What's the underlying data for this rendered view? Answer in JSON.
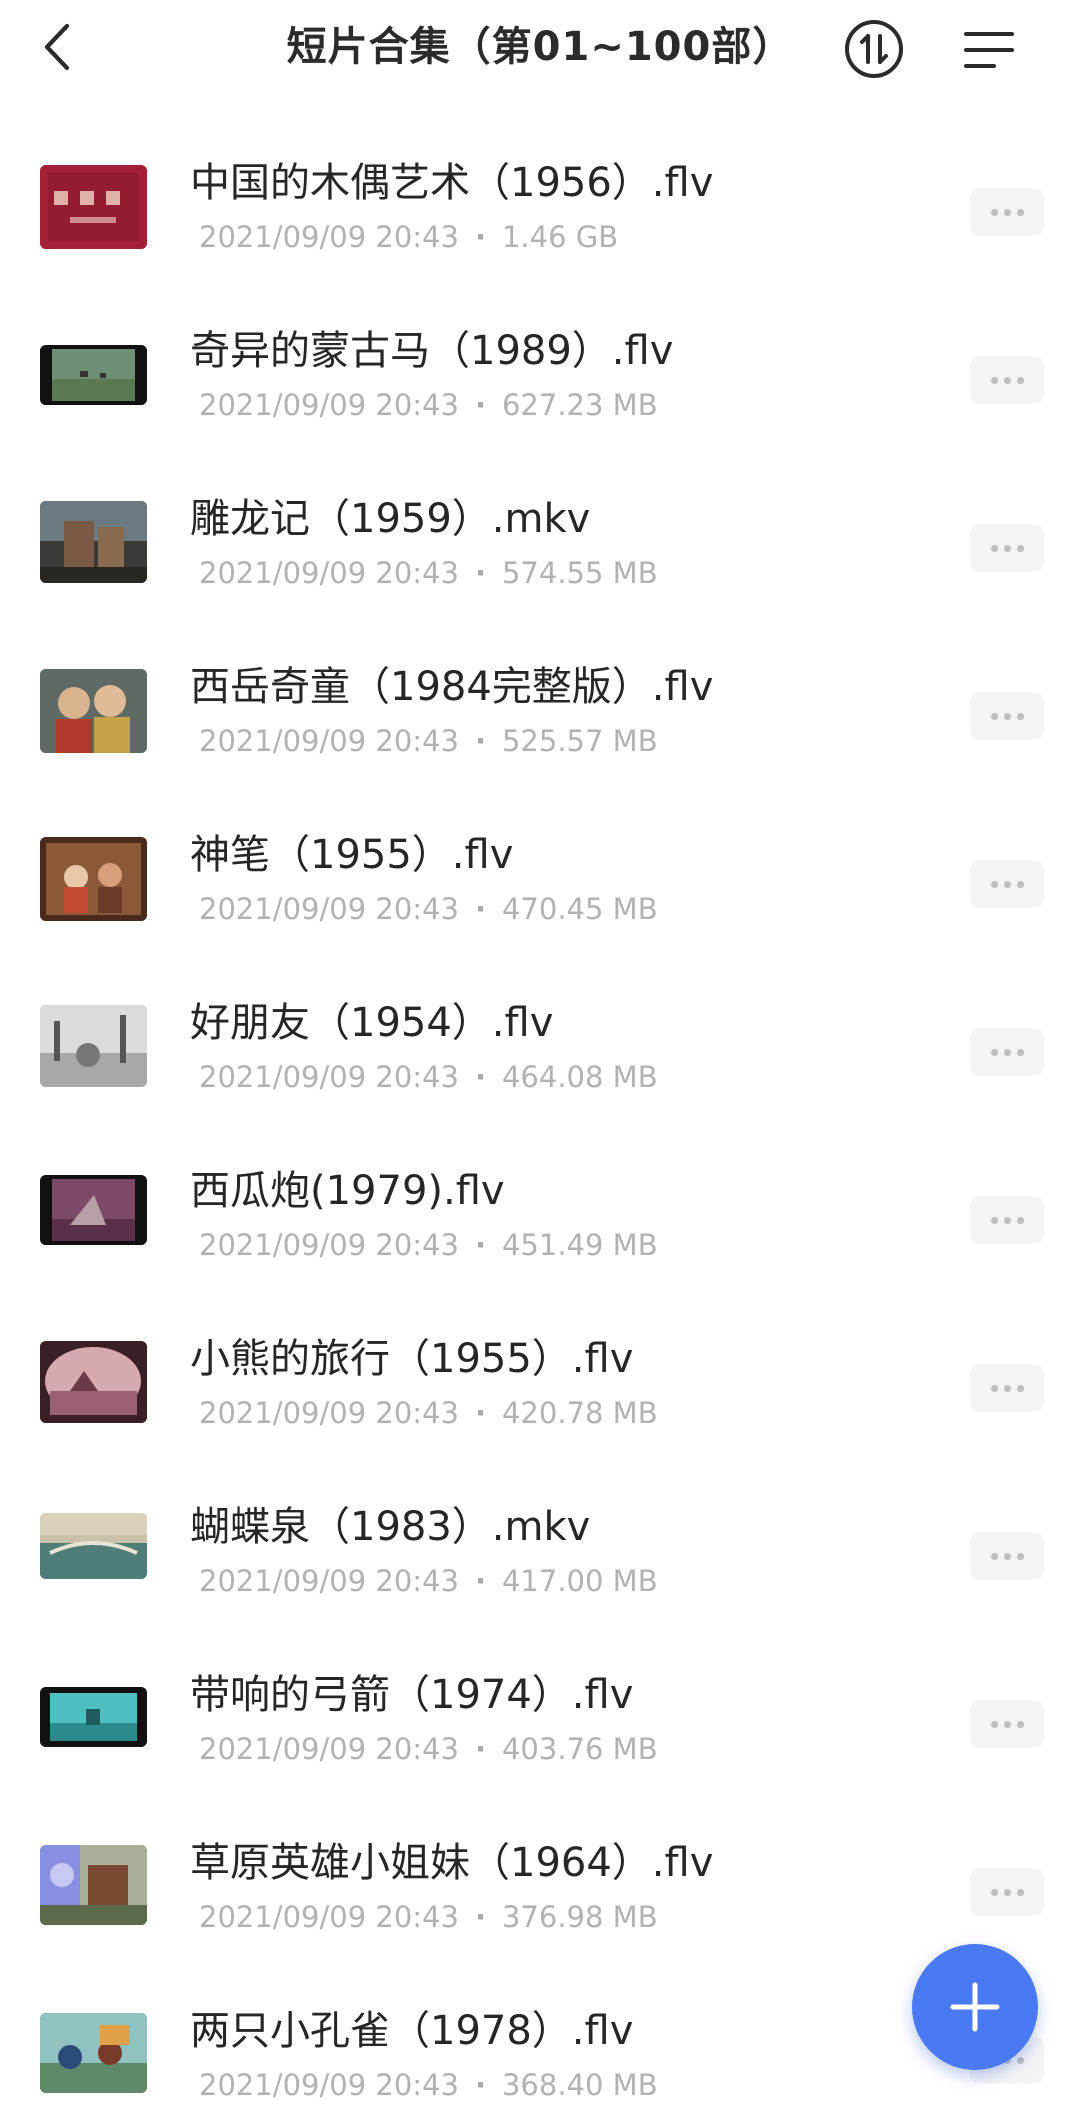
{
  "header": {
    "title": "短片合集（第01~100部）",
    "back_icon": "chevron-left-icon",
    "sort_icon": "sort-order-icon",
    "menu_icon": "list-menu-icon"
  },
  "files": [
    {
      "name": "中国的木偶艺术（1956）.flv",
      "date": "2021/09/09 20:43",
      "size": "1.46 GB",
      "thumb": "red-title-card"
    },
    {
      "name": "奇异的蒙古马（1989）.flv",
      "date": "2021/09/09 20:43",
      "size": "627.23 MB",
      "thumb": "green-field-widescreen"
    },
    {
      "name": "雕龙记（1959）.mkv",
      "date": "2021/09/09 20:43",
      "size": "574.55 MB",
      "thumb": "dark-puppets"
    },
    {
      "name": "西岳奇童（1984完整版）.flv",
      "date": "2021/09/09 20:43",
      "size": "525.57 MB",
      "thumb": "puppet-children"
    },
    {
      "name": "神笔（1955）.flv",
      "date": "2021/09/09 20:43",
      "size": "470.45 MB",
      "thumb": "brown-stage"
    },
    {
      "name": "好朋友（1954）.flv",
      "date": "2021/09/09 20:43",
      "size": "464.08 MB",
      "thumb": "grey-sketch"
    },
    {
      "name": "西瓜炮(1979).flv",
      "date": "2021/09/09 20:43",
      "size": "451.49 MB",
      "thumb": "purple-scene"
    },
    {
      "name": "小熊的旅行（1955）.flv",
      "date": "2021/09/09 20:43",
      "size": "420.78 MB",
      "thumb": "pink-landscape"
    },
    {
      "name": "蝴蝶泉（1983）.mkv",
      "date": "2021/09/09 20:43",
      "size": "417.00 MB",
      "thumb": "teal-bridge"
    },
    {
      "name": "带响的弓箭（1974）.flv",
      "date": "2021/09/09 20:43",
      "size": "403.76 MB",
      "thumb": "cyan-widescreen"
    },
    {
      "name": "草原英雄小姐妹（1964）.flv",
      "date": "2021/09/09 20:43",
      "size": "376.98 MB",
      "thumb": "blue-figures"
    },
    {
      "name": "两只小孔雀（1978）.flv",
      "date": "2021/09/09 20:43",
      "size": "368.40 MB",
      "thumb": "peacock-scene"
    }
  ],
  "more_icon": "more-dots-icon",
  "fab": {
    "icon": "plus-icon",
    "color": "#4a7af3"
  },
  "colors": {
    "accent": "#4a7af3",
    "meta_text": "#b2b2b2",
    "title_text": "#2b2b2b"
  }
}
